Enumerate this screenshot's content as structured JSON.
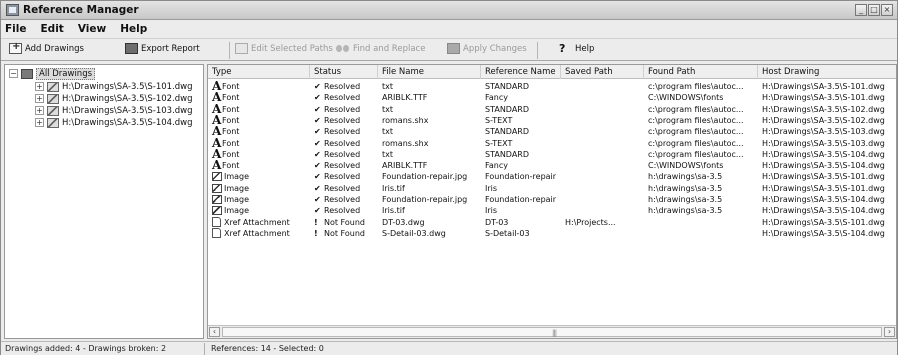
{
  "window": {
    "title": "Reference Manager",
    "controls": [
      "_",
      "□",
      "×"
    ]
  },
  "menu": [
    "File",
    "Edit",
    "View",
    "Help"
  ],
  "toolbar": {
    "add_drawings": "Add Drawings",
    "export_report": "Export Report",
    "edit_paths": "Edit Selected Paths",
    "find_replace": "Find and Replace",
    "apply_changes": "Apply Changes",
    "help": "Help"
  },
  "tree": {
    "root": "All Drawings",
    "drawings": [
      "H:\\Drawings\\SA-3.5\\S-101.dwg",
      "H:\\Drawings\\SA-3.5\\S-102.dwg",
      "H:\\Drawings\\SA-3.5\\S-103.dwg",
      "H:\\Drawings\\SA-3.5\\S-104.dwg"
    ]
  },
  "table": {
    "columns": [
      "Type",
      "Status",
      "File Name",
      "Reference Name",
      "Saved Path",
      "Found Path",
      "Host Drawing"
    ],
    "rows": [
      {
        "type": "Font",
        "icon": "font-icon",
        "status": "Resolved",
        "status_icon": "check-icon",
        "file": "txt",
        "ref": "STANDARD",
        "saved": "",
        "found": "c:\\program files\\autoc...",
        "host": "H:\\Drawings\\SA-3.5\\S-101.dwg"
      },
      {
        "type": "Font",
        "icon": "font-icon",
        "status": "Resolved",
        "status_icon": "check-icon",
        "file": "ARIBLK.TTF",
        "ref": "Fancy",
        "saved": "",
        "found": "C:\\WINDOWS\\fonts",
        "host": "H:\\Drawings\\SA-3.5\\S-101.dwg"
      },
      {
        "type": "Font",
        "icon": "font-icon",
        "status": "Resolved",
        "status_icon": "check-icon",
        "file": "txt",
        "ref": "STANDARD",
        "saved": "",
        "found": "c:\\program files\\autoc...",
        "host": "H:\\Drawings\\SA-3.5\\S-102.dwg"
      },
      {
        "type": "Font",
        "icon": "font-icon",
        "status": "Resolved",
        "status_icon": "check-icon",
        "file": "romans.shx",
        "ref": "S-TEXT",
        "saved": "",
        "found": "c:\\program files\\autoc...",
        "host": "H:\\Drawings\\SA-3.5\\S-102.dwg"
      },
      {
        "type": "Font",
        "icon": "font-icon",
        "status": "Resolved",
        "status_icon": "check-icon",
        "file": "txt",
        "ref": "STANDARD",
        "saved": "",
        "found": "c:\\program files\\autoc...",
        "host": "H:\\Drawings\\SA-3.5\\S-103.dwg"
      },
      {
        "type": "Font",
        "icon": "font-icon",
        "status": "Resolved",
        "status_icon": "check-icon",
        "file": "romans.shx",
        "ref": "S-TEXT",
        "saved": "",
        "found": "c:\\program files\\autoc...",
        "host": "H:\\Drawings\\SA-3.5\\S-103.dwg"
      },
      {
        "type": "Font",
        "icon": "font-icon",
        "status": "Resolved",
        "status_icon": "check-icon",
        "file": "txt",
        "ref": "STANDARD",
        "saved": "",
        "found": "c:\\program files\\autoc...",
        "host": "H:\\Drawings\\SA-3.5\\S-104.dwg"
      },
      {
        "type": "Font",
        "icon": "font-icon",
        "status": "Resolved",
        "status_icon": "check-icon",
        "file": "ARIBLK.TTF",
        "ref": "Fancy",
        "saved": "",
        "found": "C:\\WINDOWS\\fonts",
        "host": "H:\\Drawings\\SA-3.5\\S-104.dwg"
      },
      {
        "type": "Image",
        "icon": "image-icon",
        "status": "Resolved",
        "status_icon": "check-icon",
        "file": "Foundation-repair.jpg",
        "ref": "Foundation-repair",
        "saved": "",
        "found": "h:\\drawings\\sa-3.5",
        "host": "H:\\Drawings\\SA-3.5\\S-101.dwg"
      },
      {
        "type": "Image",
        "icon": "image-icon",
        "status": "Resolved",
        "status_icon": "check-icon",
        "file": "Iris.tif",
        "ref": "Iris",
        "saved": "",
        "found": "h:\\drawings\\sa-3.5",
        "host": "H:\\Drawings\\SA-3.5\\S-101.dwg"
      },
      {
        "type": "Image",
        "icon": "image-icon",
        "status": "Resolved",
        "status_icon": "check-icon",
        "file": "Foundation-repair.jpg",
        "ref": "Foundation-repair",
        "saved": "",
        "found": "h:\\drawings\\sa-3.5",
        "host": "H:\\Drawings\\SA-3.5\\S-104.dwg"
      },
      {
        "type": "Image",
        "icon": "image-icon",
        "status": "Resolved",
        "status_icon": "check-icon",
        "file": "Iris.tif",
        "ref": "Iris",
        "saved": "",
        "found": "h:\\drawings\\sa-3.5",
        "host": "H:\\Drawings\\SA-3.5\\S-104.dwg"
      },
      {
        "type": "Xref Attachment",
        "icon": "xref-icon",
        "status": "Not Found",
        "status_icon": "exclamation-icon",
        "file": "DT-03.dwg",
        "ref": "DT-03",
        "saved": "H:\\Projects...",
        "found": "",
        "host": "H:\\Drawings\\SA-3.5\\S-101.dwg"
      },
      {
        "type": "Xref Attachment",
        "icon": "xref-icon",
        "status": "Not Found",
        "status_icon": "exclamation-icon",
        "file": "S-Detail-03.dwg",
        "ref": "S-Detail-03",
        "saved": "",
        "found": "",
        "host": "H:\\Drawings\\SA-3.5\\S-104.dwg"
      }
    ]
  },
  "status": {
    "left": "Drawings added: 4 - Drawings broken: 2",
    "right": "References: 14 - Selected: 0"
  }
}
